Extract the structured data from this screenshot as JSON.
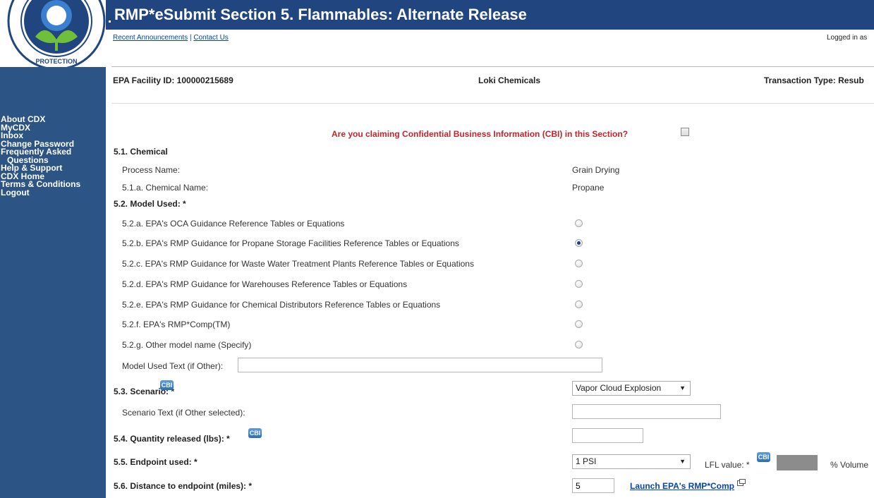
{
  "header": {
    "title": "RMP*eSubmit Section 5. Flammables: Alternate Release",
    "links": [
      "Recent Announcements",
      "Contact Us"
    ],
    "link_sep": " | ",
    "logged_in": "Logged in as"
  },
  "nav": {
    "items": [
      "About CDX",
      "MyCDX",
      "Inbox",
      "Change Password",
      "Frequently Asked",
      "Questions",
      "Help & Support",
      "CDX Home",
      "Terms & Conditions",
      "Logout"
    ]
  },
  "facility": {
    "id_label": "EPA Facility ID: 100000215689",
    "name": "Loki Chemicals",
    "transaction": "Transaction Type: Resub"
  },
  "form": {
    "cbi_question": "Are you claiming Confidential Business Information (CBI) in this Section?",
    "s51": {
      "title": "5.1. Chemical",
      "process_label": "Process Name:",
      "process_value": "Grain Drying",
      "chem_label": "5.1.a. Chemical Name:",
      "chem_value": "Propane"
    },
    "s52": {
      "title": "5.2. Model Used: *",
      "options": [
        "5.2.a. EPA's OCA Guidance Reference Tables or Equations",
        "5.2.b. EPA's RMP Guidance for Propane Storage Facilities Reference Tables or Equations",
        "5.2.c. EPA's RMP Guidance for Waste Water Treatment Plants Reference Tables or Equations",
        "5.2.d. EPA's RMP Guidance for Warehouses Reference Tables or Equations",
        "5.2.e. EPA's RMP Guidance for Chemical Distributors Reference Tables or Equations",
        "5.2.f. EPA's RMP*Comp(TM)",
        "5.2.g. Other model name (Specify)"
      ],
      "selected_index": 1,
      "other_text_label": "Model Used Text (if Other):",
      "other_text_value": ""
    },
    "s53": {
      "title": "5.3. Scenario: *",
      "scenario_value": "Vapor Cloud Explosion",
      "scenario_text_label": "Scenario Text (if Other selected):",
      "scenario_text_value": ""
    },
    "s54": {
      "title": "5.4. Quantity released (lbs): *",
      "value": ""
    },
    "s55": {
      "title": "5.5. Endpoint used: *",
      "value": "1 PSI",
      "lfl_label": "LFL value: *",
      "volume_label": "% Volume"
    },
    "s56": {
      "title": "5.6. Distance to endpoint (miles): *",
      "value": "5",
      "launch_link": "Launch EPA's RMP*Comp"
    },
    "cbi_badge": "CBI"
  },
  "colors": {
    "sidebar": "#2c5585",
    "header": "#21457f",
    "cbi_red": "#c0262a",
    "link": "#0645ad"
  }
}
